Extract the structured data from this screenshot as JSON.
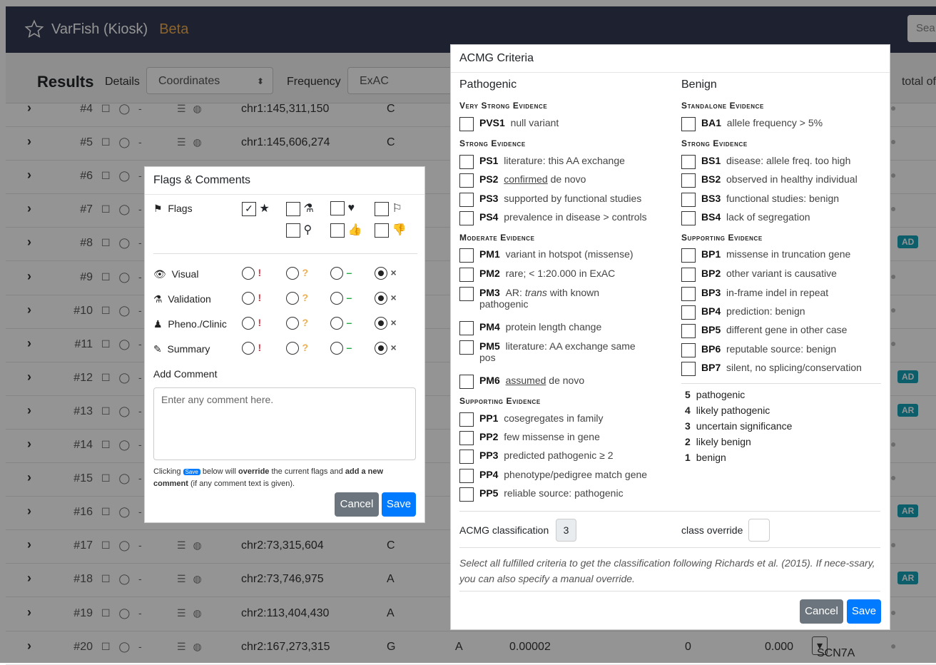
{
  "app": {
    "brand": "VarFish (Kiosk)",
    "beta": "Beta",
    "search_placeholder": "Sea"
  },
  "toolbar": {
    "results": "Results",
    "details": "Details",
    "coordinates": "Coordinates",
    "frequency": "Frequency",
    "exac": "ExAC",
    "total": "total of"
  },
  "rows": [
    {
      "num": "#4",
      "pos": "chr1:145,311,150",
      "ref": "C"
    },
    {
      "num": "#5",
      "pos": "chr1:145,606,274",
      "ref": "C"
    },
    {
      "num": "#6"
    },
    {
      "num": "#7"
    },
    {
      "num": "#8",
      "badge": "AD"
    },
    {
      "num": "#9"
    },
    {
      "num": "#10"
    },
    {
      "num": "#11"
    },
    {
      "num": "#12",
      "badge": "AD"
    },
    {
      "num": "#13",
      "badge": "AR"
    },
    {
      "num": "#14"
    },
    {
      "num": "#15"
    },
    {
      "num": "#16",
      "badge": "AR"
    },
    {
      "num": "#17",
      "pos": "chr2:73,315,604",
      "ref": "C"
    },
    {
      "num": "#18",
      "pos": "chr2:73,746,975",
      "ref": "A",
      "badge": "AR"
    },
    {
      "num": "#19",
      "pos": "chr2:113,404,430",
      "ref": "A"
    },
    {
      "num": "#20",
      "pos": "chr2:167,273,315",
      "ref": "G",
      "alt": "A",
      "freq": "0.00002",
      "hom": "0",
      "val": "0.000",
      "gene": "SCN7A"
    }
  ],
  "flags_modal": {
    "title": "Flags & Comments",
    "flags_label": "Flags",
    "visual": "Visual",
    "validation": "Validation",
    "pheno": "Pheno./Clinic",
    "summary": "Summary",
    "add_comment": "Add Comment",
    "comment_placeholder": "Enter any comment here.",
    "note1": "Clicking",
    "note_save": "Save",
    "note2": "below will",
    "note_override": "override",
    "note3": "the current flags and",
    "note_add": "add a new comment",
    "note4": "(if any comment text is given).",
    "cancel": "Cancel",
    "save": "Save"
  },
  "acmg_modal": {
    "title": "ACMG Criteria",
    "pathogenic": "Pathogenic",
    "benign": "Benign",
    "very_strong": "Very Strong Evidence",
    "strong": "Strong Evidence",
    "moderate": "Moderate Evidence",
    "supporting": "Supporting Evidence",
    "standalone": "Standalone Evidence",
    "strong_b": "Strong Evidence",
    "supporting_b": "Supporting Evidence",
    "pvs1": {
      "code": "PVS1",
      "text": "null variant"
    },
    "ps1": {
      "code": "PS1",
      "text": "literature: this AA exchange"
    },
    "ps2": {
      "code": "PS2",
      "u": "confirmed",
      "text": "de novo"
    },
    "ps3": {
      "code": "PS3",
      "text": "supported by functional studies"
    },
    "ps4": {
      "code": "PS4",
      "text": "prevalence in disease > controls"
    },
    "pm1": {
      "code": "PM1",
      "text": "variant in hotspot (missense)"
    },
    "pm2": {
      "code": "PM2",
      "text": "rare; < 1:20.000 in ExAC"
    },
    "pm3": {
      "code": "PM3",
      "pre": "AR:",
      "i": "trans",
      "text": "with known pathogenic"
    },
    "pm4": {
      "code": "PM4",
      "text": "protein length change"
    },
    "pm5": {
      "code": "PM5",
      "text": "literature: AA exchange same pos"
    },
    "pm6": {
      "code": "PM6",
      "u": "assumed",
      "text": "de novo"
    },
    "pp1": {
      "code": "PP1",
      "text": "cosegregates in family"
    },
    "pp2": {
      "code": "PP2",
      "text": "few missense in gene"
    },
    "pp3": {
      "code": "PP3",
      "text": "predicted pathogenic ≥ 2"
    },
    "pp4": {
      "code": "PP4",
      "text": "phenotype/pedigree match gene"
    },
    "pp5": {
      "code": "PP5",
      "text": "reliable source: pathogenic"
    },
    "ba1": {
      "code": "BA1",
      "text": "allele frequency > 5%"
    },
    "bs1": {
      "code": "BS1",
      "text": "disease: allele freq. too high"
    },
    "bs2": {
      "code": "BS2",
      "text": "observed in healthy individual"
    },
    "bs3": {
      "code": "BS3",
      "text": "functional studies: benign"
    },
    "bs4": {
      "code": "BS4",
      "text": "lack of segregation"
    },
    "bp1": {
      "code": "BP1",
      "text": "missense in truncation gene"
    },
    "bp2": {
      "code": "BP2",
      "text": "other variant is causative"
    },
    "bp3": {
      "code": "BP3",
      "text": "in-frame indel in repeat"
    },
    "bp4": {
      "code": "BP4",
      "text": "prediction: benign"
    },
    "bp5": {
      "code": "BP5",
      "text": "different gene in other case"
    },
    "bp6": {
      "code": "BP6",
      "text": "reputable source: benign"
    },
    "bp7": {
      "code": "BP7",
      "text": "silent, no splicing/conservation"
    },
    "classes": [
      {
        "n": "5",
        "label": "pathogenic"
      },
      {
        "n": "4",
        "label": "likely pathogenic"
      },
      {
        "n": "3",
        "label": "uncertain significance"
      },
      {
        "n": "2",
        "label": "likely benign"
      },
      {
        "n": "1",
        "label": "benign"
      }
    ],
    "classification_label": "ACMG classification",
    "classification_value": "3",
    "override_label": "class override",
    "footnote": "Select all fulfilled criteria to get the classification following Richards et al. (2015). If nece-ssary, you can also specify a manual override.",
    "cancel": "Cancel",
    "save": "Save"
  }
}
